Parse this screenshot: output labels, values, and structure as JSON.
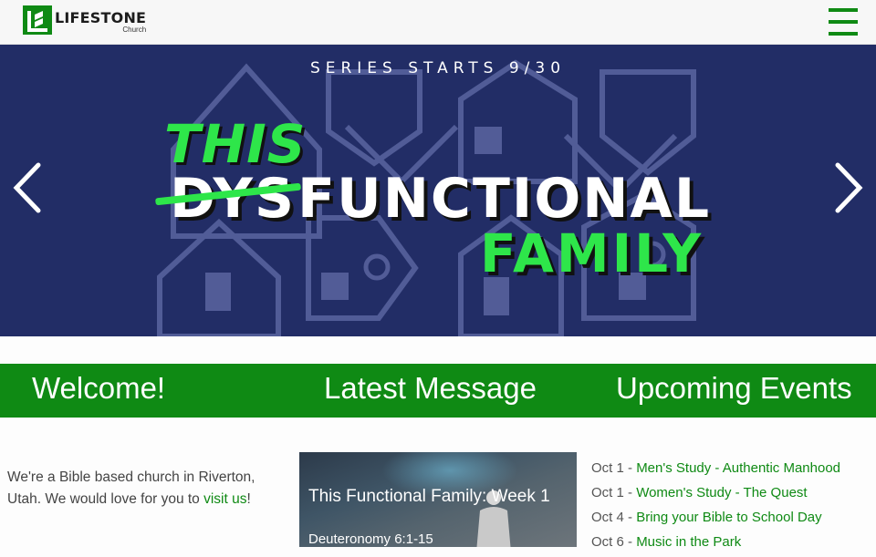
{
  "header": {
    "logo_name": "LIFESTONE",
    "logo_sub": "Church",
    "menu_icon": "hamburger-menu-icon",
    "brand_color": "#0f8a14"
  },
  "hero": {
    "series_line": "SERIES STARTS 9/30",
    "word_this": "THIS",
    "word_dys": "DYS",
    "word_functional": "FUNCTIONAL",
    "word_family": "FAMILY",
    "background_color": "#222d66",
    "accent_color": "#2ee64a",
    "prev_icon": "chevron-left-icon",
    "next_icon": "chevron-right-icon"
  },
  "sections": {
    "welcome": "Welcome!",
    "latest_message": "Latest Message",
    "upcoming_events": "Upcoming Events"
  },
  "welcome": {
    "text_before": "We're a Bible based church in Riverton, Utah. We would love for you to ",
    "link": "visit us",
    "text_after": "!"
  },
  "latest_message": {
    "title": "This Functional Family: Week 1",
    "scripture": "Deuteronomy 6:1-15"
  },
  "events": [
    {
      "date": "Oct 1 - ",
      "title": "Men's Study - Authentic Manhood"
    },
    {
      "date": "Oct 1 - ",
      "title": "Women's Study - The Quest"
    },
    {
      "date": "Oct 4 - ",
      "title": "Bring your Bible to School Day"
    },
    {
      "date": "Oct 6 - ",
      "title": "Music in the Park"
    }
  ]
}
